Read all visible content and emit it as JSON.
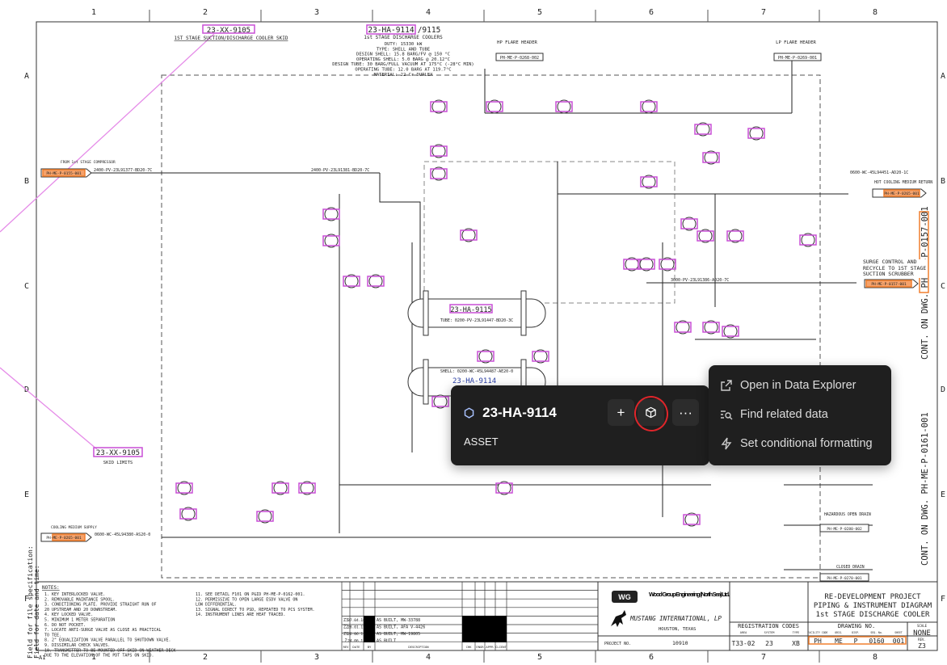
{
  "drawing": {
    "grid_columns": [
      "1",
      "2",
      "3",
      "4",
      "5",
      "6",
      "7",
      "8"
    ],
    "grid_rows": [
      "A",
      "B",
      "C",
      "D",
      "E",
      "F"
    ],
    "sheet_size": "A1",
    "skid_tag_top": "23-XX-9105",
    "skid_desc_top": "1ST STAGE SUCTION/DISCHARGE COOLER SKID",
    "skid_tag_left": "23-XX-9105",
    "skid_limits": "SKID LIMITS",
    "cooler_tag": "23-HA-9114",
    "cooler_tag_suffix": "/9115",
    "cooler_title": "1st STAGE DISCHARGE COOLERS",
    "cooler_specs": [
      "DUTY: 15330 kW",
      "TYPE: SHELL AND TUBE",
      "DESIGN SHELL:  15.8 BARG/FV @ 150 °C",
      "OPERATING SHELL: 5.0 BARG @ 20.12°C",
      "DESIGN TUBE:  30 BARG/FULL VACUUM AT 175°C (-28°C MIN)",
      "OPERATING TUBE: 12.0 BARG AT 119.7°C",
      "MATERIAL: 22 Cr DUPLEX"
    ],
    "hp_flare_header": "HP FLARE HEADER",
    "hp_flare_ref": "PH-ME-P-0268-002",
    "lp_flare_header": "LP FLARE HEADER",
    "lp_flare_ref": "PH-ME-P-0269-001",
    "from_compressor": "FROM 1st STAGE COMPRESSOR",
    "from_compressor_ref": "PH-ME-P-0155-001",
    "line_inlet": "2400-PV-23L91377-BD20-7C",
    "line_inlet_2": "2400-PV-23L91381-BD20-7C",
    "cooling_supply": "COOLING MEDIUM SUPPLY",
    "cooling_supply_ref": "PH-ME-P-0265-001",
    "line_cooling": "0600-WC-45L94380-AS20-0",
    "hot_cooling_return": "HOT COOLING MEDIUM RETURN",
    "hot_cooling_ref": "PH-ME-P-0265-001",
    "line_hot_return": "0600-WC-45L94451-AD20-1C",
    "surge_control": "SURGE CONTROL AND RECYCLE TO 1ST STAGE SUCTION SCRUBBER",
    "surge_ref": "PH-ME-P-0157-001",
    "line_recycle": "3000-PV-23L91386-AD20-7C",
    "exchanger_upper": "23-HA-9115",
    "exchanger_lower": "23-HA-9114",
    "tube_line": "TUBE: 0200-PV-23L91447-BD20-3C",
    "shell_line": "SHELL: 0200-WC-45L94487-AE20-0",
    "hazardous_drain": "HAZARDOUS OPEN DRAIN",
    "hazardous_drain_ref": "PH-ME-P-0280-002",
    "closed_drain": "CLOSED DRAIN",
    "closed_drain_ref": "PH-ME-P-0270-001",
    "cont_on_dwg_1": "CONT. ON DWG. PH-ME-P-0157-001",
    "cont_on_dwg_2": "CONT. ON DWG. PH-ME-P-0161-001",
    "side_field_1": "Field for file specification:",
    "side_field_2": "Field for date and time:"
  },
  "notes": {
    "heading": "NOTES:",
    "left": [
      "1. KEY INTERLOCKED VALVE.",
      "2. REMOVABLE MAINTANCE SPOOL.",
      "3. CONDITIONING PLATE. PROVIDE STRAIGHT RUN OF",
      "   20 UPSTREAM AND 20 DOWNSTREAM.",
      "4. KEY LOCKED VALVE.",
      "5. MINIMUM 1 METER SEPARATION",
      "6. DO NOT POCKET.",
      "7. LOCATE ANTI-SURGE VALVE AS CLOSE AS PRACTICAL",
      "   TO TEE.",
      "8. 2\" EQUALIZATION VALVE PARALLEL TO SHUTDOWN VALVE.",
      "9. DISSIMILAR CHECK VALVES.",
      "10. TRANSMITTER TO BE MOUNTED OFF SKID ON WEATHER DECK",
      "    DUE TO THE ELEVATION OF THE PDT TAPS ON SKID."
    ],
    "right": [
      "11. SEE DETAIL F101 ON P&ID PH-ME-P-0162-001.",
      "12. PERMISSIVE TO OPEN LARGE ESDV VALVE ON",
      "    LOW DIFFERENTIAL.",
      "13. SIGNAL DIRECT TO PSD, REPEATED TO PCS SYSTEM.",
      "14. INSTRUMENT LINES ARE HEAT TRACED."
    ]
  },
  "revisions": {
    "headers": [
      "REV",
      "DATE",
      "BY",
      "DESCRIPTION",
      "CHK",
      "ENGR",
      "APPR",
      "CLIENT"
    ],
    "rows": [
      {
        "rev": "Z3",
        "date": "37.04.16",
        "desc": "AS BUILT, MW-33788"
      },
      {
        "rev": "Z2",
        "date": "28.01.15",
        "desc": "AS BUILT, AFA V-4426"
      },
      {
        "rev": "Z1",
        "date": "26.06.14",
        "desc": "AS BUILT, MW-19805"
      },
      {
        "rev": "Z",
        "date": "24.06.13",
        "desc": "AS BUILT"
      }
    ]
  },
  "title_block": {
    "company_1": "Wood Group Engineering (North Sea) Ltd.",
    "company_1_logo": "WG",
    "company_2": "MUSTANG INTERNATIONAL, LP",
    "company_2_city": "HOUSTON, TEXAS",
    "project_no_label": "PROJECT NO.",
    "project_no": "10910",
    "registration_codes": "REGISTRATION CODES",
    "reg_labels": [
      "AREA",
      "SYSTEM",
      "TYPE"
    ],
    "reg_values": [
      "T33-02",
      "23",
      "XB"
    ],
    "title_lines": [
      "RE-DEVELOPMENT PROJECT",
      "PIPING & INSTRUMENT DIAGRAM",
      "1st STAGE DISCHARGE COOLER"
    ],
    "drawing_no_label": "DRAWING NO.",
    "drawing_no_labels": [
      "FACILITY CODE",
      "ORIG.",
      "DISP.",
      "SEQ. No.",
      "SHEET"
    ],
    "drawing_no_values": [
      "PH",
      "ME",
      "P",
      "0160",
      "001"
    ],
    "scale_label": "SCALE",
    "scale": "NONE",
    "rev_label": "REV.",
    "rev": "Z3"
  },
  "popup": {
    "asset_tag": "23-HA-9114",
    "asset_type": "ASSET",
    "add_label": "+",
    "more_label": "···",
    "icon_asset": "hexagon-icon",
    "icon_3d": "cube-icon"
  },
  "context_menu": {
    "items": [
      {
        "label": "Open in Data Explorer",
        "icon": "external-link-icon"
      },
      {
        "label": "Find related data",
        "icon": "search-list-icon"
      },
      {
        "label": "Set conditional formatting",
        "icon": "lightning-icon"
      }
    ]
  },
  "colors": {
    "highlight_asset": "#c94fd6",
    "highlight_file": "#f07f2e",
    "popup_bg": "#1f1f1f",
    "focus_ring": "#e0252a"
  }
}
